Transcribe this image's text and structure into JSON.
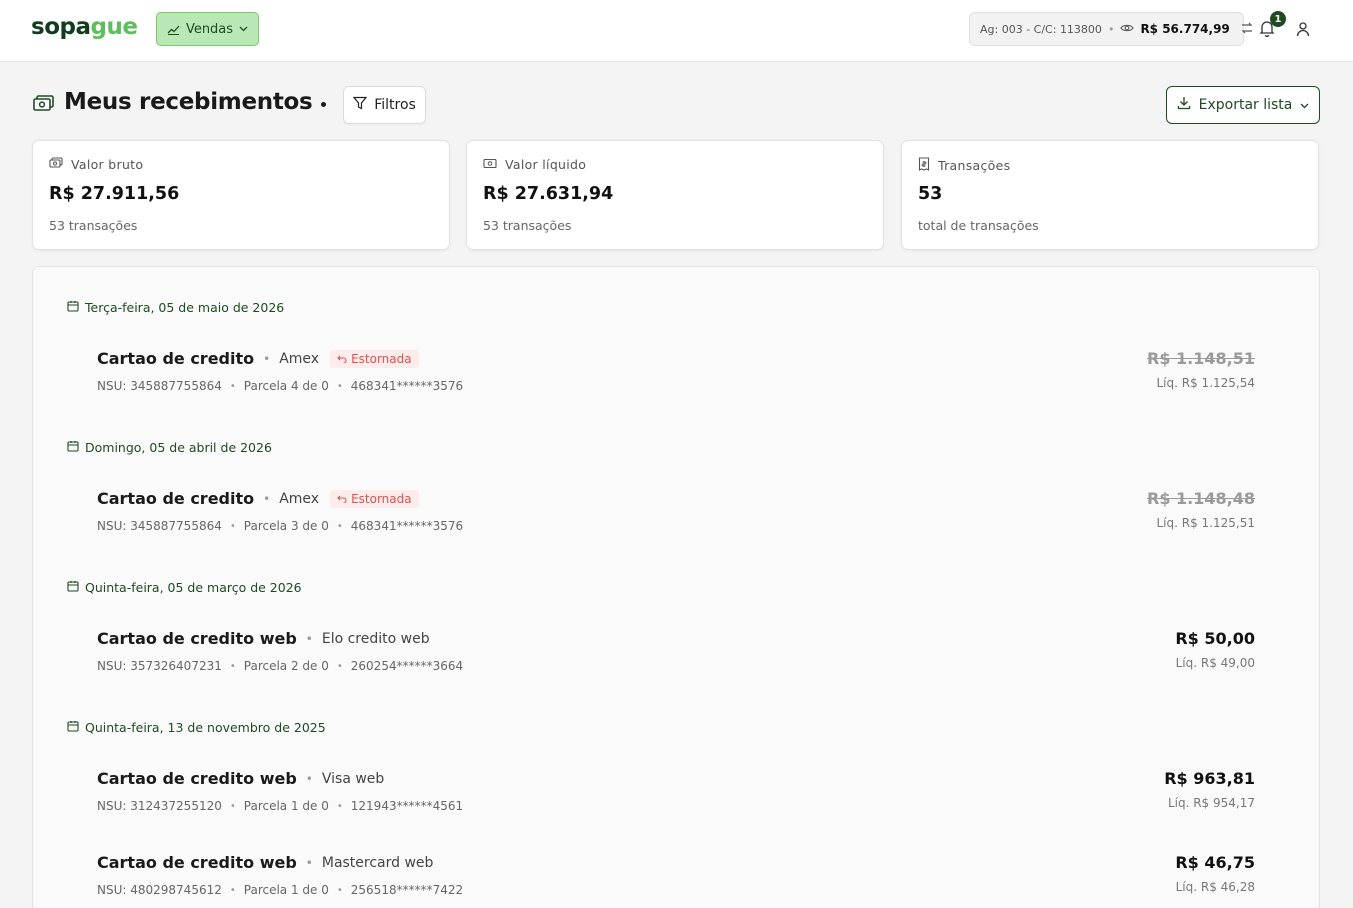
{
  "header": {
    "logo_main": "sopa",
    "logo_accent": "gue",
    "menu_label": "Vendas",
    "account_info": "Ag: 003 - C/C: 113800",
    "balance": "R$ 56.774,99",
    "notification_count": "1"
  },
  "page": {
    "title": "Meus recebimentos",
    "filters_label": "Filtros",
    "export_label": "Exportar lista"
  },
  "summary": [
    {
      "label": "Valor bruto",
      "value": "R$ 27.911,56",
      "sub": "53 transações",
      "icon": "money-icon"
    },
    {
      "label": "Valor líquido",
      "value": "R$ 27.631,94",
      "sub": "53 transações",
      "icon": "cash-icon"
    },
    {
      "label": "Transações",
      "value": "53",
      "sub": "total de transações",
      "icon": "receipt-icon"
    }
  ],
  "groups": [
    {
      "date": "Terça-feira, 05 de maio de 2026",
      "transactions": [
        {
          "name": "Cartao de credito",
          "brand": "Amex",
          "tag": "Estornada",
          "nsu": "NSU: 345887755864",
          "parcela": "Parcela 4 de 0",
          "card": "468341******3576",
          "amount": "R$ 1.148,51",
          "liquid": "Líq. R$ 1.125,54",
          "struck": true
        }
      ]
    },
    {
      "date": "Domingo, 05 de abril de 2026",
      "transactions": [
        {
          "name": "Cartao de credito",
          "brand": "Amex",
          "tag": "Estornada",
          "nsu": "NSU: 345887755864",
          "parcela": "Parcela 3 de 0",
          "card": "468341******3576",
          "amount": "R$ 1.148,48",
          "liquid": "Líq. R$ 1.125,51",
          "struck": true
        }
      ]
    },
    {
      "date": "Quinta-feira, 05 de março de 2026",
      "transactions": [
        {
          "name": "Cartao de credito web",
          "brand": "Elo credito web",
          "tag": "",
          "nsu": "NSU: 357326407231",
          "parcela": "Parcela 2 de 0",
          "card": "260254******3664",
          "amount": "R$ 50,00",
          "liquid": "Líq. R$ 49,00",
          "struck": false
        }
      ]
    },
    {
      "date": "Quinta-feira, 13 de novembro de 2025",
      "transactions": [
        {
          "name": "Cartao de credito web",
          "brand": "Visa web",
          "tag": "",
          "nsu": "NSU: 312437255120",
          "parcela": "Parcela 1 de 0",
          "card": "121943******4561",
          "amount": "R$ 963,81",
          "liquid": "Líq. R$ 954,17",
          "struck": false
        },
        {
          "name": "Cartao de credito web",
          "brand": "Mastercard web",
          "tag": "",
          "nsu": "NSU: 480298745612",
          "parcela": "Parcela 1 de 0",
          "card": "256518******7422",
          "amount": "R$ 46,75",
          "liquid": "Líq. R$ 46,28",
          "struck": false
        }
      ]
    }
  ]
}
